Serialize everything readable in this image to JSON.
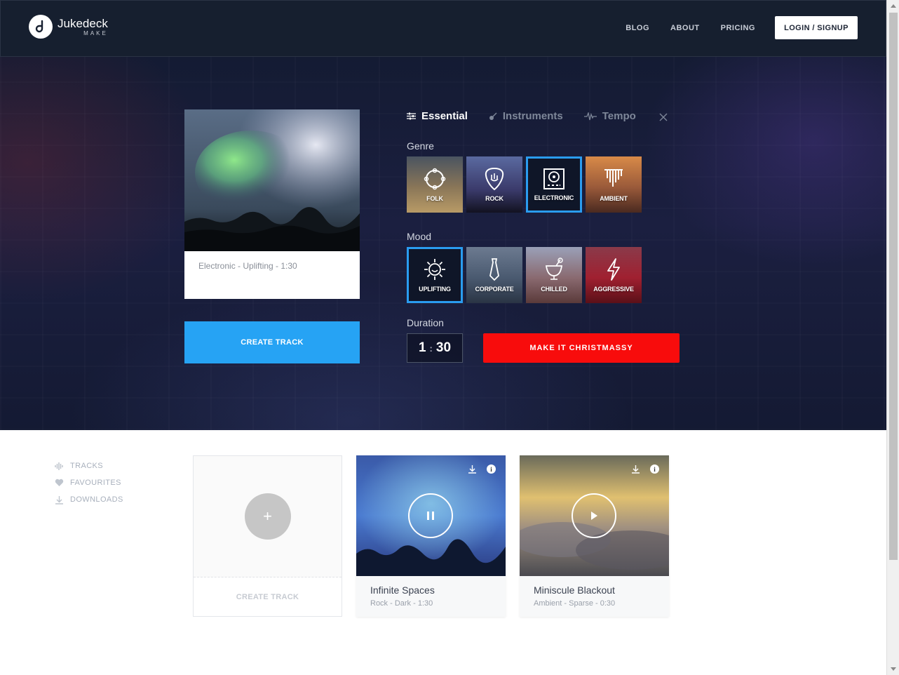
{
  "header": {
    "logo_name": "Jukedeck",
    "logo_sub": "MAKE",
    "nav": [
      "BLOG",
      "ABOUT",
      "PRICING"
    ],
    "login_label": "LOGIN / SIGNUP"
  },
  "hero": {
    "track_meta": "Electronic - Uplifting - 1:30",
    "create_label": "CREATE TRACK",
    "tabs": [
      {
        "label": "Essential",
        "icon": "sliders-icon"
      },
      {
        "label": "Instruments",
        "icon": "guitar-icon"
      },
      {
        "label": "Tempo",
        "icon": "pulse-icon"
      }
    ],
    "genre_label": "Genre",
    "genres": [
      "FOLK",
      "ROCK",
      "ELECTRONIC",
      "AMBIENT"
    ],
    "mood_label": "Mood",
    "moods": [
      "UPLIFTING",
      "CORPORATE",
      "CHILLED",
      "AGGRESSIVE"
    ],
    "duration_label": "Duration",
    "duration_min": "1",
    "duration_sec": "30",
    "xmas_label": "MAKE IT CHRISTMASSY",
    "selected_genre": "ELECTRONIC",
    "selected_mood": "UPLIFTING"
  },
  "sidebar": {
    "items": [
      "TRACKS",
      "FAVOURITES",
      "DOWNLOADS"
    ]
  },
  "cards": {
    "create_label": "CREATE TRACK",
    "plus": "+",
    "info": "i",
    "tracks": [
      {
        "title": "Infinite Spaces",
        "meta": "Rock - Dark - 1:30",
        "state": "pause"
      },
      {
        "title": "Miniscule Blackout",
        "meta": "Ambient - Sparse - 0:30",
        "state": "play"
      }
    ]
  },
  "colors": {
    "accent": "#26a3f4",
    "red": "#f80c0c",
    "header": "#161f2f"
  }
}
